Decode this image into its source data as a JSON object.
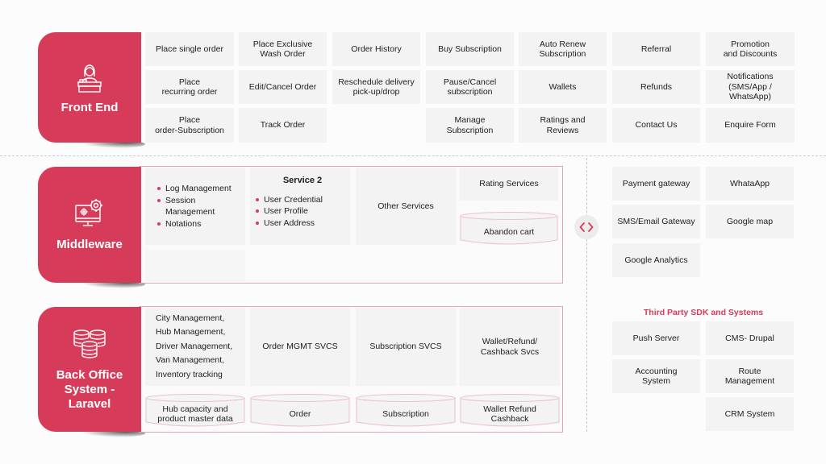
{
  "colors": {
    "accent": "#d63c5a",
    "cell_bg": "#f3f3f3",
    "container_border": "#e7a4b2",
    "background": "#fcfcfc"
  },
  "front_end": {
    "title": "Front End",
    "icon": "receptionist-icon",
    "cells": [
      "Place single order",
      "Place Exclusive\nWash Order",
      "Order History",
      "Buy Subscription",
      "Auto Renew\nSubscription",
      "Referral",
      "Promotion\nand Discounts",
      "Place\nrecurring order",
      "Edit/Cancel Order",
      "Reschedule delivery\npick-up/drop",
      "Pause/Cancel\nsubscription",
      "Wallets",
      "Refunds",
      "Notifications\n(SMS/App /\nWhatsApp)",
      "Place\norder-Subscription",
      "Track Order",
      "Manage\nSubscription",
      "Ratings and\nReviews",
      "Contact Us",
      "Enquire Form"
    ]
  },
  "middleware": {
    "title": "Middleware",
    "icon": "monitor-gears-icon",
    "service1_items": [
      "Log Management",
      "Session Management",
      "Notations"
    ],
    "service2": {
      "title": "Service 2",
      "items": [
        "User Credential",
        "User Profile",
        "User Address"
      ]
    },
    "other_services": "Other Services",
    "rating_services": "Rating Services",
    "abandon_cart": "Abandon cart"
  },
  "back_office": {
    "title": "Back Office\nSystem -\nLaravel",
    "icon": "database-stack-icon",
    "services": [
      "City Management,\nHub Management,\nDriver Management,\nVan Management,\nInventory tracking",
      "Order MGMT SVCS",
      "Subscription SVCS",
      "Wallet/Refund/\nCashback Svcs"
    ],
    "databases": [
      "Hub capacity and\nproduct master data",
      "Order",
      "Subscription",
      "Wallet Refund\nCashback"
    ]
  },
  "integrations": {
    "connector_icon": "code-brackets-icon",
    "cells": [
      "Payment gateway",
      "WhataApp",
      "SMS/Email Gateway",
      "Google map",
      "Google Analytics"
    ]
  },
  "third_party": {
    "title": "Third Party SDK and Systems",
    "cells": [
      "Push Server",
      "CMS- Drupal",
      "Accounting\nSystem",
      "Route\nManagement",
      "CRM System"
    ]
  }
}
